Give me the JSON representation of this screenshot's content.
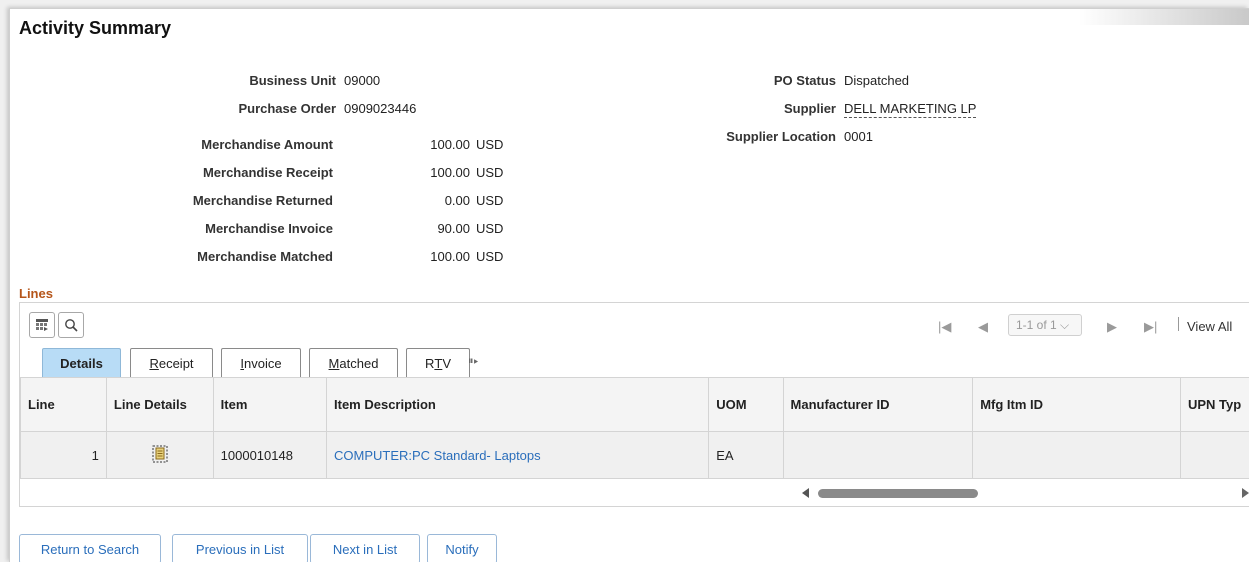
{
  "page": {
    "title": "Activity Summary"
  },
  "header": {
    "business_unit": {
      "label": "Business Unit",
      "value": "09000"
    },
    "purchase_order": {
      "label": "Purchase Order",
      "value": "0909023446"
    },
    "po_status": {
      "label": "PO Status",
      "value": "Dispatched"
    },
    "supplier": {
      "label": "Supplier",
      "value": "DELL MARKETING LP"
    },
    "supplier_location": {
      "label": "Supplier Location",
      "value": "0001"
    }
  },
  "amounts": [
    {
      "label": "Merchandise Amount",
      "amount": "100.00",
      "currency": "USD"
    },
    {
      "label": "Merchandise Receipt",
      "amount": "100.00",
      "currency": "USD"
    },
    {
      "label": "Merchandise Returned",
      "amount": "0.00",
      "currency": "USD"
    },
    {
      "label": "Merchandise Invoice",
      "amount": "90.00",
      "currency": "USD"
    },
    {
      "label": "Merchandise Matched",
      "amount": "100.00",
      "currency": "USD"
    }
  ],
  "lines": {
    "title": "Lines",
    "pager": {
      "range": "1-1 of 1",
      "view_all": "View All"
    },
    "tabs": [
      {
        "label": "Details",
        "underline": "",
        "rest": "Details"
      },
      {
        "label": "Receipt",
        "underline": "R",
        "rest": "eceipt"
      },
      {
        "label": "Invoice",
        "underline": "I",
        "rest": "nvoice"
      },
      {
        "label": "Matched",
        "underline": "M",
        "rest": "atched"
      },
      {
        "label": "RTV",
        "pre": "R",
        "underline": "T",
        "rest": "V"
      }
    ],
    "columns": [
      "Line",
      "Line Details",
      "Item",
      "Item Description",
      "UOM",
      "Manufacturer ID",
      "Mfg Itm ID",
      "UPN Typ"
    ],
    "rows": [
      {
        "line": "1",
        "item": "1000010148",
        "description": "COMPUTER:PC Standard- Laptops",
        "uom": "EA",
        "manufacturer_id": "",
        "mfg_itm_id": "",
        "upn_type": ""
      }
    ]
  },
  "buttons": {
    "return_to_search": "Return to Search",
    "previous_in_list": "Previous in List",
    "next_in_list": "Next in List",
    "notify": "Notify"
  },
  "icons": {
    "personalize": "grid-settings-icon",
    "find": "search-icon",
    "line_details": "document-details-icon"
  },
  "colors": {
    "link": "#2a6ebb",
    "section_title": "#b5551a",
    "active_tab": "#b8dcf6"
  }
}
